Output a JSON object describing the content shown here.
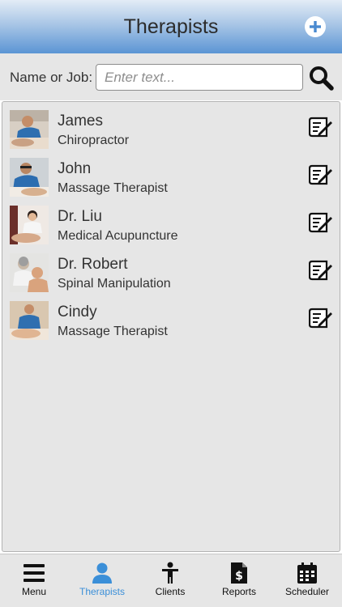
{
  "header": {
    "title": "Therapists",
    "add_icon": "plus-circle-icon"
  },
  "search": {
    "label": "Name or Job:",
    "placeholder": "Enter text...",
    "value": ""
  },
  "therapists": [
    {
      "name": "James",
      "job": "Chiropractor"
    },
    {
      "name": "John",
      "job": "Massage Therapist"
    },
    {
      "name": "Dr. Liu",
      "job": "Medical Acupuncture"
    },
    {
      "name": "Dr. Robert",
      "job": "Spinal Manipulation"
    },
    {
      "name": "Cindy",
      "job": "Massage Therapist"
    }
  ],
  "tabs": [
    {
      "label": "Menu",
      "icon": "hamburger-menu-icon",
      "active": false
    },
    {
      "label": "Therapists",
      "icon": "person-icon",
      "active": true
    },
    {
      "label": "Clients",
      "icon": "standing-person-icon",
      "active": false
    },
    {
      "label": "Reports",
      "icon": "dollar-document-icon",
      "active": false
    },
    {
      "label": "Scheduler",
      "icon": "calendar-icon",
      "active": false
    }
  ],
  "colors": {
    "accent": "#3b8fd8",
    "header_top": "#e3ecf6",
    "header_bottom": "#5b95d4",
    "panel_bg": "#e6e6e6"
  }
}
